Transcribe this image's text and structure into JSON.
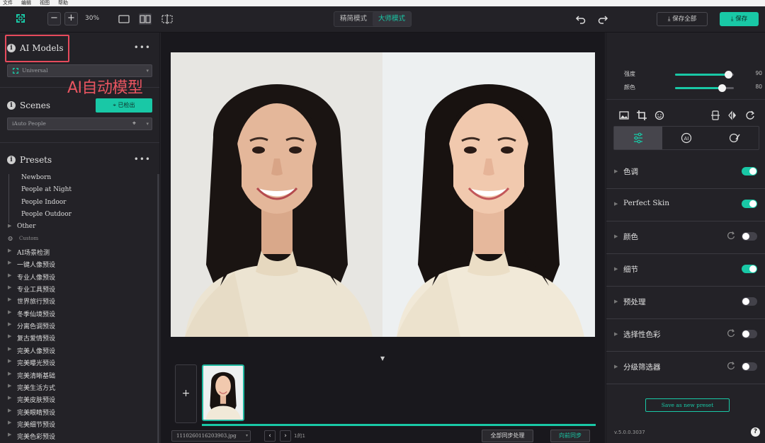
{
  "menu": [
    "文件",
    "编辑",
    "视图",
    "帮助"
  ],
  "toolbar": {
    "zoom_minus": "−",
    "zoom_plus": "+",
    "zoom_value": "30%",
    "mode_simple": "精简模式",
    "mode_master": "大师模式",
    "save_all": "保存全部",
    "save": "保存",
    "accent": "#19c8a6"
  },
  "left": {
    "ai_models_title": "AI Models",
    "model_value": "Universal",
    "annotation": "AI自动模型",
    "scenes_title": "Scenes",
    "detect_button": "已检出",
    "scene_value": "iAuto People",
    "presets_title": "Presets",
    "more": "•••",
    "tree": [
      {
        "label": "Newborn",
        "level": 2,
        "arrow": false
      },
      {
        "label": "People at Night",
        "level": 2,
        "arrow": false
      },
      {
        "label": "People Indoor",
        "level": 2,
        "arrow": false
      },
      {
        "label": "People Outdoor",
        "level": 2,
        "arrow": false
      },
      {
        "label": "Other",
        "level": 1,
        "arrow": true
      },
      {
        "label": "Custom",
        "level": 1,
        "arrow": false,
        "icon": "user",
        "small": true
      },
      {
        "label": "AI场景检测",
        "level": 1,
        "arrow": true
      },
      {
        "label": "一键人像预设",
        "level": 1,
        "arrow": true
      },
      {
        "label": "专业人像预设",
        "level": 1,
        "arrow": true
      },
      {
        "label": "专业工具预设",
        "level": 1,
        "arrow": true
      },
      {
        "label": "世界旅行预设",
        "level": 1,
        "arrow": true
      },
      {
        "label": "冬季仙境预设",
        "level": 1,
        "arrow": true
      },
      {
        "label": "分离色调预设",
        "level": 1,
        "arrow": true
      },
      {
        "label": "复古爱情预设",
        "level": 1,
        "arrow": true
      },
      {
        "label": "完美人像预设",
        "level": 1,
        "arrow": true
      },
      {
        "label": "完美曝光预设",
        "level": 1,
        "arrow": true
      },
      {
        "label": "完美清晰基础",
        "level": 1,
        "arrow": true
      },
      {
        "label": "完美生活方式",
        "level": 1,
        "arrow": true
      },
      {
        "label": "完美皮肤预设",
        "level": 1,
        "arrow": true
      },
      {
        "label": "完美眼睛预设",
        "level": 1,
        "arrow": true
      },
      {
        "label": "完美细节预设",
        "level": 1,
        "arrow": true
      },
      {
        "label": "完美色彩预设",
        "level": 1,
        "arrow": true
      }
    ]
  },
  "center": {
    "add_label": "+",
    "filename": "1110260116203903.jpg",
    "page_count": "1的1",
    "sync_all": "全部同步处理",
    "sync_back": "向前同步",
    "progress": 1.0
  },
  "right": {
    "sliders": [
      {
        "label": "强度",
        "value": 90
      },
      {
        "label": "颜色",
        "value": 80
      }
    ],
    "adjustments": [
      {
        "label": "色调",
        "on": true,
        "reset": false
      },
      {
        "label": "Perfect Skin",
        "on": true,
        "reset": false
      },
      {
        "label": "颜色",
        "on": false,
        "reset": true
      },
      {
        "label": "细节",
        "on": true,
        "reset": false
      },
      {
        "label": "预处理",
        "on": false,
        "reset": false
      },
      {
        "label": "选择性色彩",
        "on": false,
        "reset": true
      },
      {
        "label": "分级筛选器",
        "on": false,
        "reset": true
      }
    ],
    "save_preset": "Save as new preset",
    "version": "v.5.0.0.3037",
    "help": "?"
  }
}
